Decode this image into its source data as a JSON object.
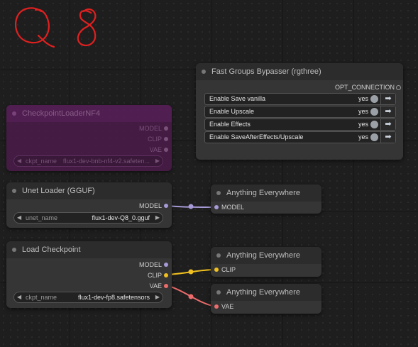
{
  "annotation": {
    "text": "Q 8",
    "color": "#e02020"
  },
  "fast_groups": {
    "title": "Fast Groups Bypasser (rgthree)",
    "output": "OPT_CONNECTION",
    "toggles": [
      {
        "label": "Enable Save vanilla",
        "value": "yes"
      },
      {
        "label": "Enable Upscale",
        "value": "yes"
      },
      {
        "label": "Enable Effects",
        "value": "yes"
      },
      {
        "label": "Enable SaveAfterEffects/Upscale",
        "value": "yes"
      }
    ]
  },
  "nf4": {
    "title": "CheckpointLoaderNF4",
    "outputs": [
      "MODEL",
      "CLIP",
      "VAE"
    ],
    "widget": {
      "name": "ckpt_name",
      "value": "flux1-dev-bnb-nf4-v2.safeten..."
    }
  },
  "unet": {
    "title": "Unet Loader (GGUF)",
    "output": "MODEL",
    "widget": {
      "name": "unet_name",
      "value": "flux1-dev-Q8_0.gguf"
    }
  },
  "ckpt": {
    "title": "Load Checkpoint",
    "outputs": [
      "MODEL",
      "CLIP",
      "VAE"
    ],
    "widget": {
      "name": "ckpt_name",
      "value": "flux1-dev-fp8.safetensors"
    }
  },
  "anything1": {
    "title": "Anything Everywhere",
    "input": "MODEL"
  },
  "anything2": {
    "title": "Anything Everywhere",
    "input": "CLIP"
  },
  "anything3": {
    "title": "Anything Everywhere",
    "input": "VAE"
  },
  "colors": {
    "model": "#a79ad6",
    "clip": "#f0c020",
    "vae": "#ee6b6b",
    "bypass": "#4a1b4a"
  }
}
